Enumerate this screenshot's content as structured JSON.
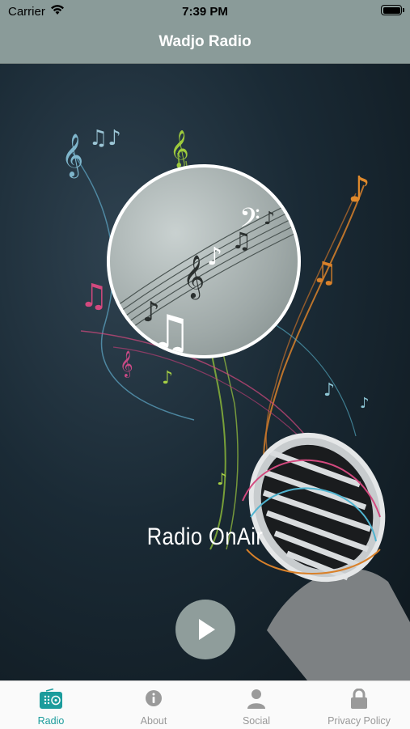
{
  "status_bar": {
    "carrier": "Carrier",
    "time": "7:39 PM"
  },
  "nav": {
    "title": "Wadjo Radio"
  },
  "player": {
    "station_name": "Radio OnAir",
    "state": "paused"
  },
  "tabs": [
    {
      "label": "Radio",
      "icon": "radio-icon",
      "active": true
    },
    {
      "label": "About",
      "icon": "info-icon",
      "active": false
    },
    {
      "label": "Social",
      "icon": "user-icon",
      "active": false
    },
    {
      "label": "Privacy Policy",
      "icon": "lock-icon",
      "active": false
    }
  ],
  "colors": {
    "bar": "#8a9b99",
    "accent": "#1b9c9c",
    "play": "#8f9d9b"
  }
}
